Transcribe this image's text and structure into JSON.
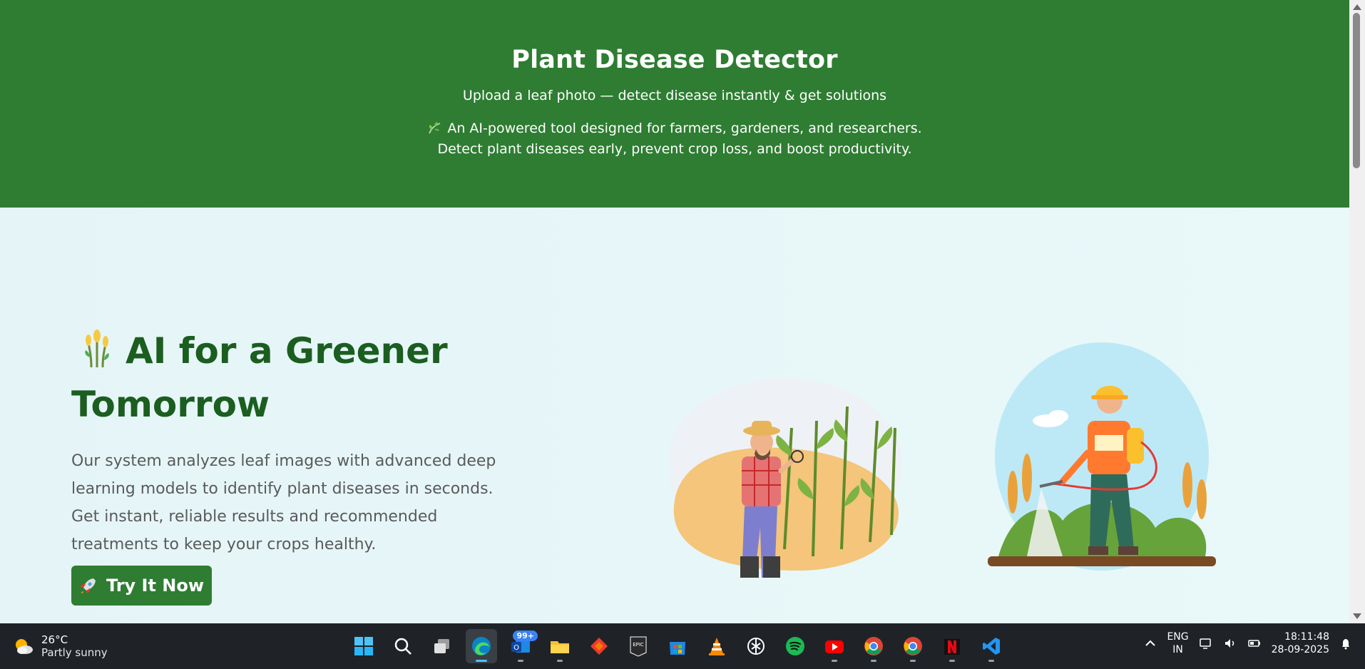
{
  "hero": {
    "title": "Plant Disease Detector",
    "subtitle": "Upload a leaf photo — detect disease instantly & get solutions",
    "description_line1": "An AI-powered tool designed for farmers, gardeners, and researchers.",
    "description_line2": "Detect plant diseases early, prevent crop loss, and boost productivity."
  },
  "main": {
    "headline_line1": "AI for a Greener",
    "headline_line2": "Tomorrow",
    "body": "Our system analyzes leaf images with advanced deep learning models to identify plant diseases in seconds. Get instant, reliable results and recommended treatments to keep your crops healthy.",
    "cta_label": "Try It Now"
  },
  "taskbar": {
    "weather_temp": "26°C",
    "weather_condition": "Partly sunny",
    "mail_badge": "99+",
    "apps": [
      "windows-start",
      "search",
      "task-view",
      "edge",
      "outlook",
      "file-explorer",
      "anydesk",
      "epic-games",
      "microsoft-store",
      "vlc",
      "chatgpt",
      "spotify",
      "youtube",
      "chrome",
      "chrome-profile",
      "netflix",
      "vscode"
    ],
    "language": "ENG",
    "region": "IN",
    "time": "18:11:48",
    "date": "28-09-2025"
  },
  "colors": {
    "hero_bg": "#2e7d32",
    "headline": "#1b5e20",
    "cta_bg": "#2e7d32",
    "page_bg": "#e6f6f7",
    "taskbar_bg": "#1f2328"
  }
}
